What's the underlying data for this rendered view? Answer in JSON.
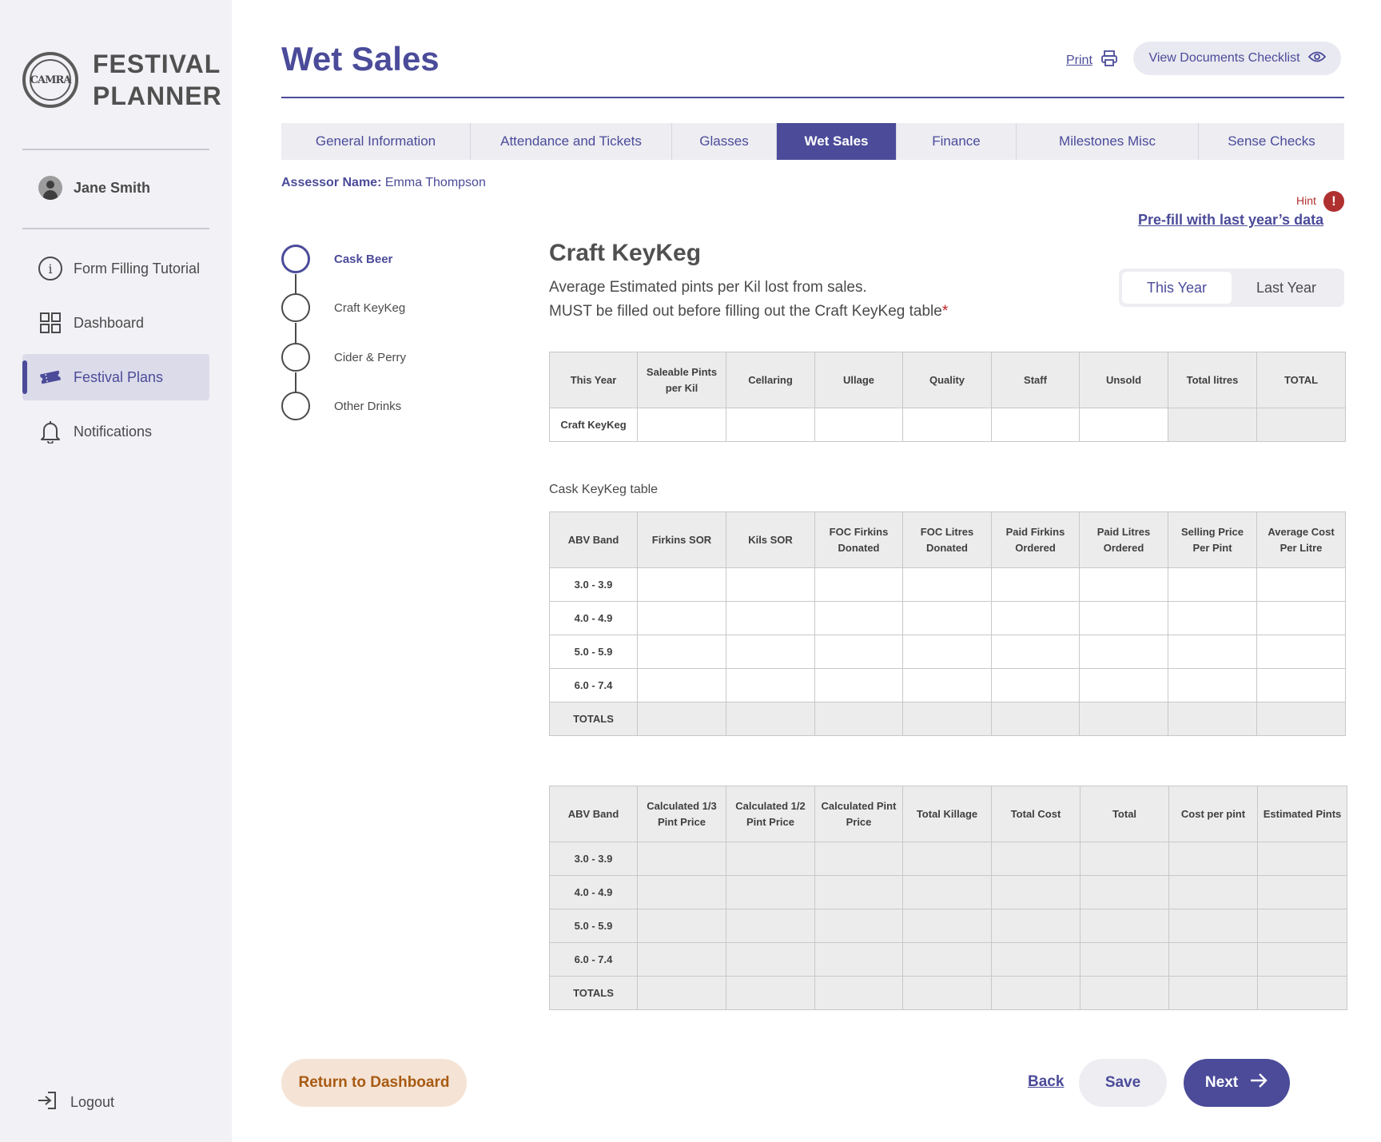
{
  "app": {
    "logo_badge_text": "CAMRA",
    "logo_line1": "FESTIVAL",
    "logo_line2": "PLANNER"
  },
  "sidebar": {
    "user_name": "Jane Smith",
    "items": [
      {
        "label": "Form Filling Tutorial",
        "icon": "info-icon"
      },
      {
        "label": "Dashboard",
        "icon": "grid-icon"
      },
      {
        "label": "Festival Plans",
        "icon": "ticket-icon",
        "active": true
      },
      {
        "label": "Notifications",
        "icon": "bell-icon"
      }
    ],
    "logout_label": "Logout"
  },
  "header": {
    "title": "Wet Sales",
    "print_label": "Print",
    "documents_label": "View Documents Checklist"
  },
  "tabs": [
    {
      "label": "General Information"
    },
    {
      "label": "Attendance and Tickets"
    },
    {
      "label": "Glasses"
    },
    {
      "label": "Wet Sales",
      "active": true
    },
    {
      "label": "Finance"
    },
    {
      "label": "Milestones Misc"
    },
    {
      "label": "Sense Checks"
    }
  ],
  "assessor": {
    "label": "Assessor Name:",
    "value": "Emma Thompson"
  },
  "hint": {
    "label": "Hint",
    "icon": "!",
    "prefill_label": "Pre-fill with last year’s data"
  },
  "steps": [
    {
      "label": "Cask Beer",
      "active": true
    },
    {
      "label": "Craft KeyKeg"
    },
    {
      "label": "Cider & Perry"
    },
    {
      "label": "Other Drinks"
    }
  ],
  "section": {
    "title": "Craft KeyKeg",
    "desc_line1": "Average Estimated pints per Kil lost from sales.",
    "desc_line2": "MUST be filled out before filling out the Craft KeyKeg table",
    "required_mark": "*"
  },
  "year_toggle": {
    "this_year": "This Year",
    "last_year": "Last Year"
  },
  "loss_table": {
    "headers": [
      "This Year",
      "Saleable Pints per Kil",
      "Cellaring",
      "Ullage",
      "Quality",
      "Staff",
      "Unsold",
      "Total litres",
      "TOTAL"
    ],
    "row_label": "Craft KeyKeg"
  },
  "cask_table": {
    "label": "Cask KeyKeg table",
    "headers": [
      "ABV Band",
      "Firkins SOR",
      "Kils SOR",
      "FOC Firkins Donated",
      "FOC Litres Donated",
      "Paid Firkins Ordered",
      "Paid Litres Ordered",
      "Selling Price Per Pint",
      "Average Cost Per Litre"
    ],
    "rows": [
      "3.0 - 3.9",
      "4.0 - 4.9",
      "5.0 - 5.9",
      "6.0 - 7.4"
    ],
    "totals_label": "TOTALS"
  },
  "calc_table": {
    "headers": [
      "ABV Band",
      "Calculated 1/3 Pint Price",
      "Calculated 1/2 Pint Price",
      "Calculated Pint Price",
      "Total Killage",
      "Total Cost",
      "Total",
      "Cost per pint",
      "Estimated Pints"
    ],
    "rows": [
      "3.0 - 3.9",
      "4.0 - 4.9",
      "5.0 - 5.9",
      "6.0 - 7.4"
    ],
    "totals_label": "TOTALS"
  },
  "footer": {
    "return_label": "Return to Dashboard",
    "back_label": "Back",
    "save_label": "Save",
    "next_label": "Next"
  },
  "colors": {
    "brand": "#4b4b9a",
    "sidebar_bg": "#f1f1f6",
    "hint_red": "#b03030",
    "return_bg": "#f5e4d6",
    "return_text": "#a85a12"
  }
}
